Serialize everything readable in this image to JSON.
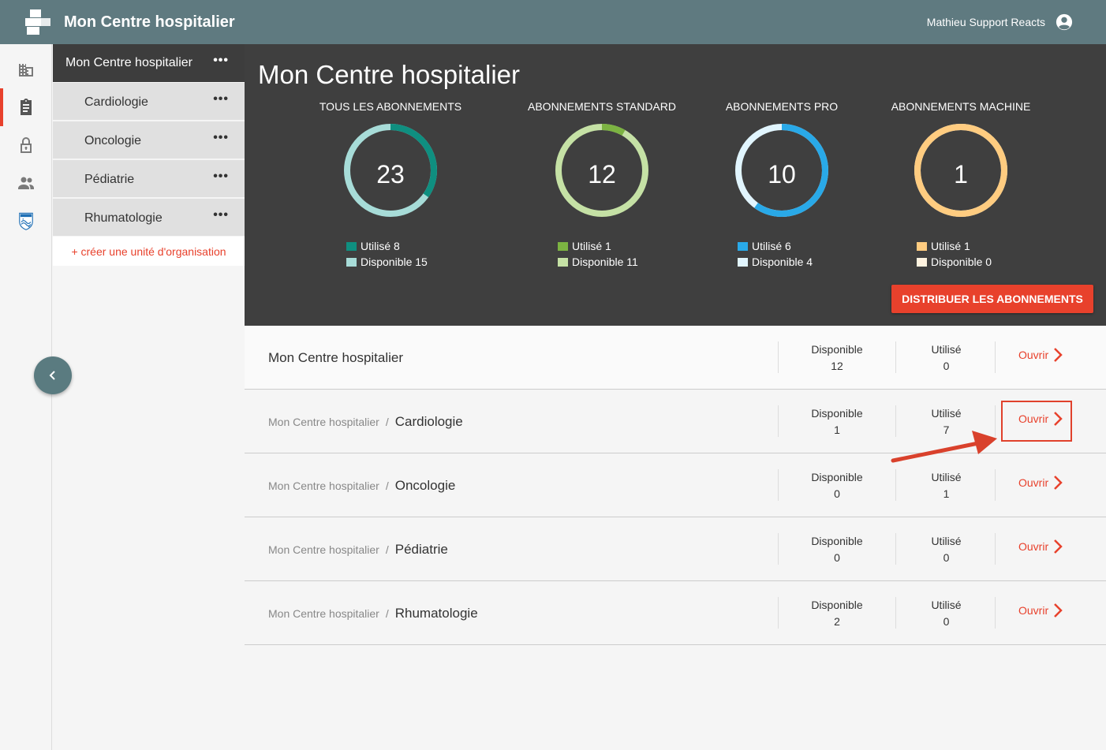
{
  "header": {
    "app_title": "Mon Centre hospitalier",
    "user_name": "Mathieu Support Reacts"
  },
  "rail": {
    "items": [
      {
        "icon": "building-icon",
        "active": false
      },
      {
        "icon": "clipboard-icon",
        "active": true
      },
      {
        "icon": "lock-icon",
        "active": false
      },
      {
        "icon": "people-icon",
        "active": false
      },
      {
        "icon": "philips-shield-icon",
        "active": false
      }
    ]
  },
  "org_tree": {
    "root": {
      "label": "Mon Centre hospitalier",
      "menu": "•••"
    },
    "children": [
      {
        "label": "Cardiologie",
        "menu": "•••"
      },
      {
        "label": "Oncologie",
        "menu": "•••"
      },
      {
        "label": "Pédiatrie",
        "menu": "•••"
      },
      {
        "label": "Rhumatologie",
        "menu": "•••"
      }
    ],
    "create_link": "+ créer une unité d'organisation"
  },
  "summary": {
    "title": "Mon Centre hospitalier",
    "rings": [
      {
        "label": "TOUS LES ABONNEMENTS",
        "total": "23",
        "used_label": "Utilisé 8",
        "avail_label": "Disponible 15",
        "used": 8,
        "available": 15,
        "used_color": "#0f8f80",
        "avail_color": "#a7dcd8"
      },
      {
        "label": "ABONNEMENTS STANDARD",
        "total": "12",
        "used_label": "Utilisé 1",
        "avail_label": "Disponible 11",
        "used": 1,
        "available": 11,
        "used_color": "#7cb342",
        "avail_color": "#c5e1a5"
      },
      {
        "label": "ABONNEMENTS PRO",
        "total": "10",
        "used_label": "Utilisé 6",
        "avail_label": "Disponible 4",
        "used": 6,
        "available": 4,
        "used_color": "#29a9e8",
        "avail_color": "#e1f5fe"
      },
      {
        "label": "ABONNEMENTS MACHINE",
        "total": "1",
        "used_label": "Utilisé 1",
        "avail_label": "Disponible 0",
        "used": 1,
        "available": 0,
        "used_color": "#ffcc80",
        "avail_color": "#fff3e0"
      }
    ],
    "distribute_button": "DISTRIBUER LES ABONNEMENTS"
  },
  "units": [
    {
      "parent": "",
      "name": "Mon Centre hospitalier",
      "disp_label": "Disponible",
      "disp_value": "12",
      "used_label": "Utilisé",
      "used_value": "0",
      "open_label": "Ouvrir"
    },
    {
      "parent": "Mon Centre hospitalier",
      "sep": "/",
      "name": "Cardiologie",
      "disp_label": "Disponible",
      "disp_value": "1",
      "used_label": "Utilisé",
      "used_value": "7",
      "open_label": "Ouvrir",
      "highlighted": true
    },
    {
      "parent": "Mon Centre hospitalier",
      "sep": "/",
      "name": "Oncologie",
      "disp_label": "Disponible",
      "disp_value": "0",
      "used_label": "Utilisé",
      "used_value": "1",
      "open_label": "Ouvrir"
    },
    {
      "parent": "Mon Centre hospitalier",
      "sep": "/",
      "name": "Pédiatrie",
      "disp_label": "Disponible",
      "disp_value": "0",
      "used_label": "Utilisé",
      "used_value": "0",
      "open_label": "Ouvrir"
    },
    {
      "parent": "Mon Centre hospitalier",
      "sep": "/",
      "name": "Rhumatologie",
      "disp_label": "Disponible",
      "disp_value": "2",
      "used_label": "Utilisé",
      "used_value": "0",
      "open_label": "Ouvrir"
    }
  ],
  "colors": {
    "accent": "#e8412c",
    "topbar": "#5f7a80",
    "hero_bg": "#3f3f3f"
  }
}
